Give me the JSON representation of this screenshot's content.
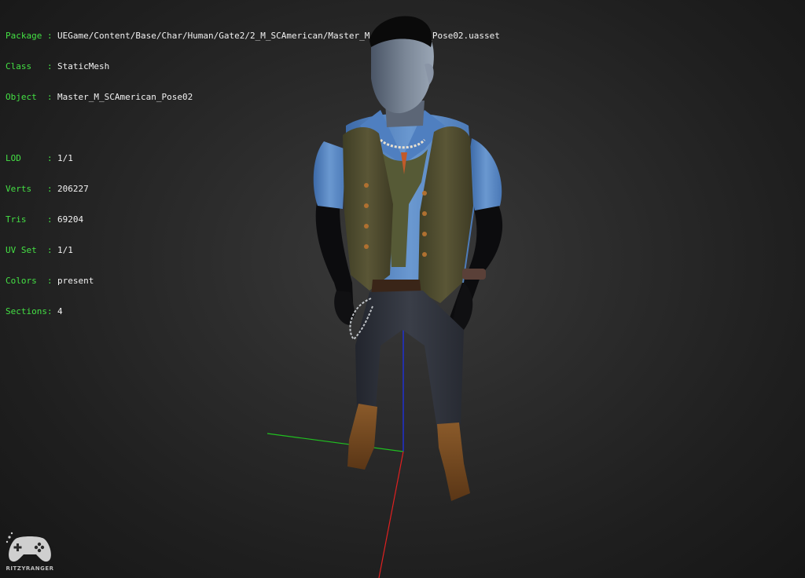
{
  "mesh_info": {
    "rows": [
      {
        "key": "Package",
        "value": "UEGame/Content/Base/Char/Human/Gate2/2_M_SCAmerican/Master_M_SCAmerican_Pose02.uasset"
      },
      {
        "key": "Class",
        "value": "StaticMesh"
      },
      {
        "key": "Object",
        "value": "Master_M_SCAmerican_Pose02"
      }
    ],
    "stats": [
      {
        "key": "LOD",
        "value": "1/1"
      },
      {
        "key": "Verts",
        "value": "206227"
      },
      {
        "key": "Tris",
        "value": "69204"
      },
      {
        "key": "UV Set",
        "value": "1/1"
      },
      {
        "key": "Colors",
        "value": "present"
      },
      {
        "key": "Sections",
        "value": "4"
      }
    ],
    "separator": ":"
  },
  "watermark": {
    "text": "RITZYRANGER",
    "icon": "gamepad-icon"
  },
  "axis_colors": {
    "x": "#e02020",
    "y": "#20c020",
    "z": "#2030d0"
  }
}
